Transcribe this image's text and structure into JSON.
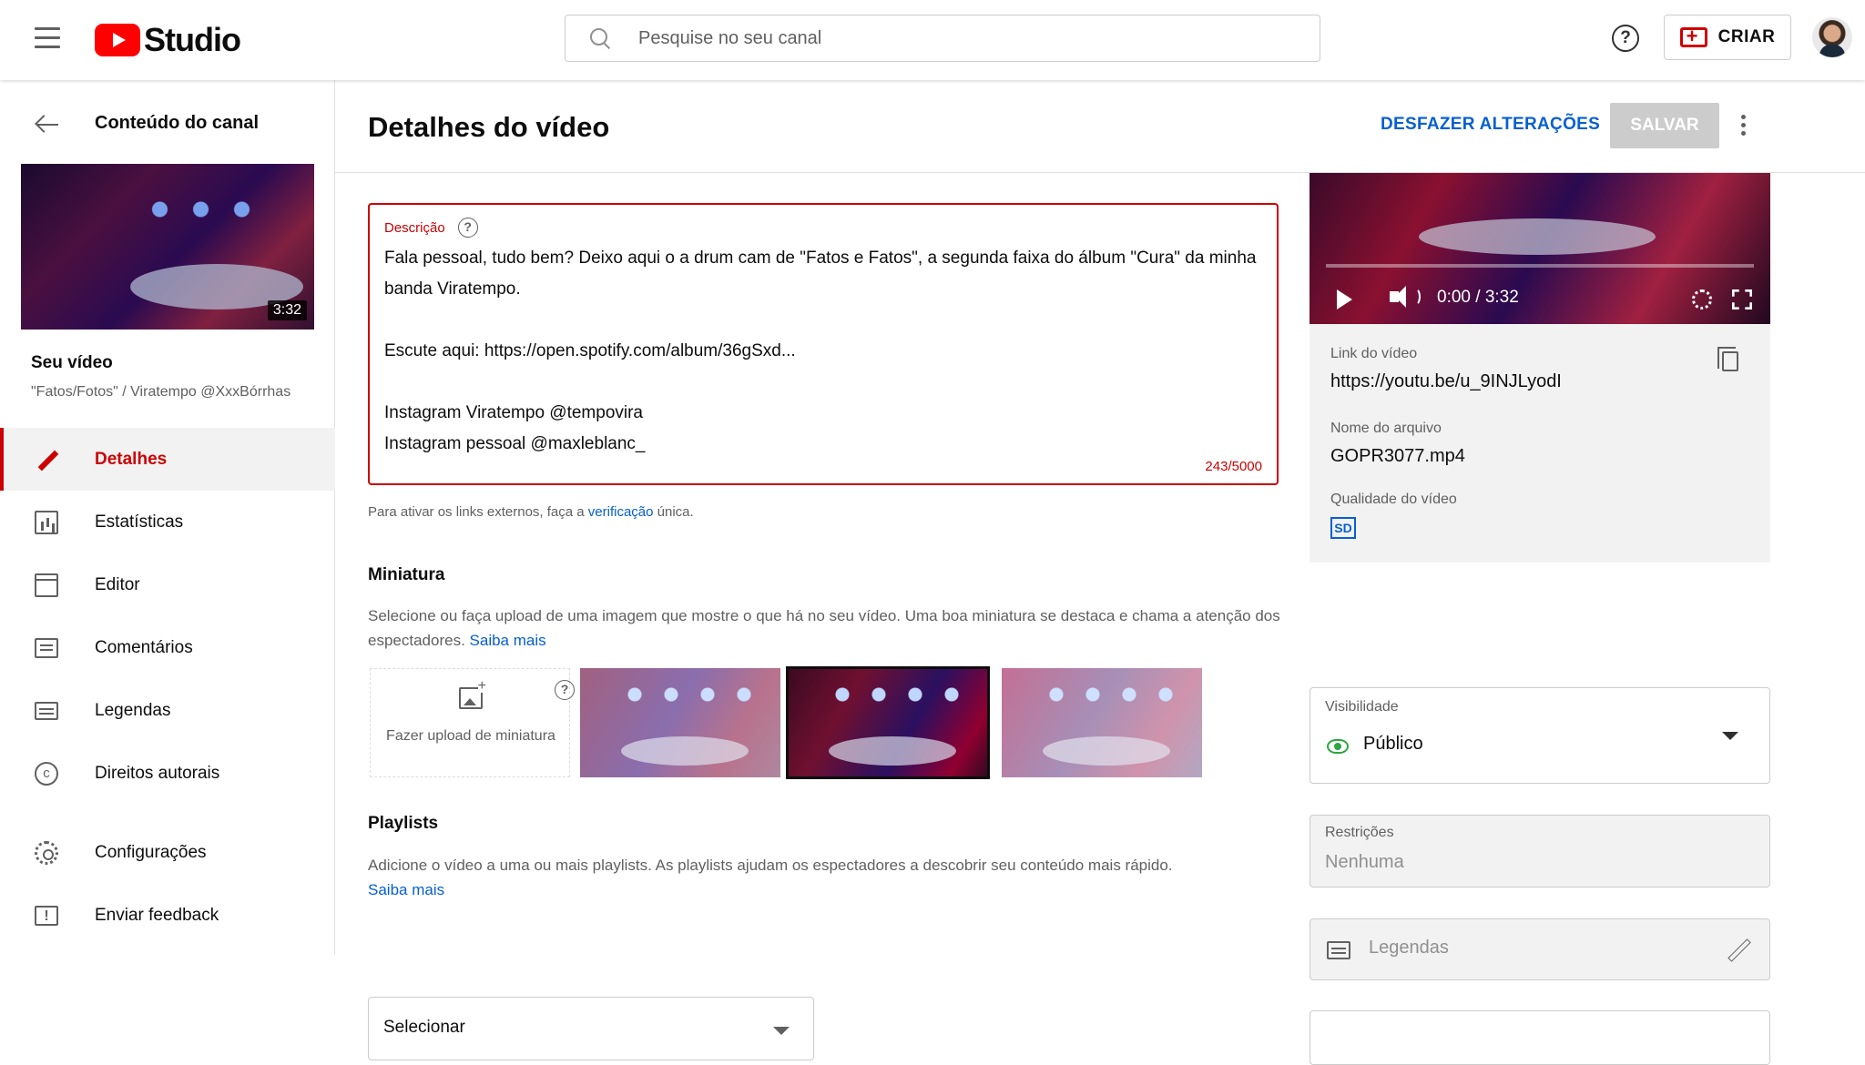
{
  "header": {
    "brand": "Studio",
    "search_placeholder": "Pesquise no seu canal",
    "help_icon": "?",
    "create_label": "CRIAR"
  },
  "sidebar": {
    "back_label": "Conteúdo do canal",
    "thumb_duration": "3:32",
    "your_video_label": "Seu vídeo",
    "video_subtitle": "\"Fatos/Fotos\" / Viratempo @XxxBórrhas",
    "items": [
      {
        "label": "Detalhes",
        "icon": "pencil-icon",
        "active": true
      },
      {
        "label": "Estatísticas",
        "icon": "stats-icon"
      },
      {
        "label": "Editor",
        "icon": "editor-icon"
      },
      {
        "label": "Comentários",
        "icon": "comments-icon"
      },
      {
        "label": "Legendas",
        "icon": "subtitles-icon"
      },
      {
        "label": "Direitos autorais",
        "icon": "copyright-icon"
      },
      {
        "label": "Configurações",
        "icon": "gear-icon"
      },
      {
        "label": "Enviar feedback",
        "icon": "feedback-icon"
      }
    ]
  },
  "main": {
    "title": "Detalhes do vídeo",
    "undo_label": "DESFAZER ALTERAÇÕES",
    "save_label": "SALVAR",
    "description": {
      "label": "Descrição",
      "text": "Fala pessoal, tudo bem? Deixo aqui o a drum cam de \"Fatos e Fatos\", a segunda faixa do álbum \"Cura\" da minha banda Viratempo.\n\nEscute aqui: https://open.spotify.com/album/36gSxd...\n\nInstagram Viratempo @tempovira\nInstagram pessoal @maxleblanc_",
      "count": "243/5000"
    },
    "hint_prefix": "Para ativar os links externos, faça a ",
    "hint_link": "verificação",
    "hint_suffix": " única.",
    "thumbnail": {
      "title": "Miniatura",
      "desc": "Selecione ou faça upload de uma imagem que mostre o que há no seu vídeo. Uma boa miniatura se destaca e chama a atenção dos espectadores.",
      "learn_more": "Saiba mais",
      "upload_label": "Fazer upload de miniatura"
    },
    "playlists": {
      "title": "Playlists",
      "desc": "Adicione o vídeo a uma ou mais playlists. As playlists ajudam os espectadores a descobrir seu conteúdo mais rápido.",
      "learn_more": "Saiba mais",
      "select_label": "Selecionar"
    }
  },
  "right": {
    "player_time": "0:00 / 3:32",
    "link_label": "Link do vídeo",
    "link_value": "https://youtu.be/u_9INJLyodI",
    "filename_label": "Nome do arquivo",
    "filename_value": "GOPR3077.mp4",
    "quality_label": "Qualidade do vídeo",
    "quality_badge": "SD",
    "visibility_label": "Visibilidade",
    "visibility_value": "Público",
    "restrictions_label": "Restrições",
    "restrictions_value": "Nenhuma",
    "subtitles_value": "Legendas"
  },
  "colors": {
    "accent_red": "#cc0000",
    "link_blue": "#065fd4",
    "visibility_green": "#2ba640"
  }
}
